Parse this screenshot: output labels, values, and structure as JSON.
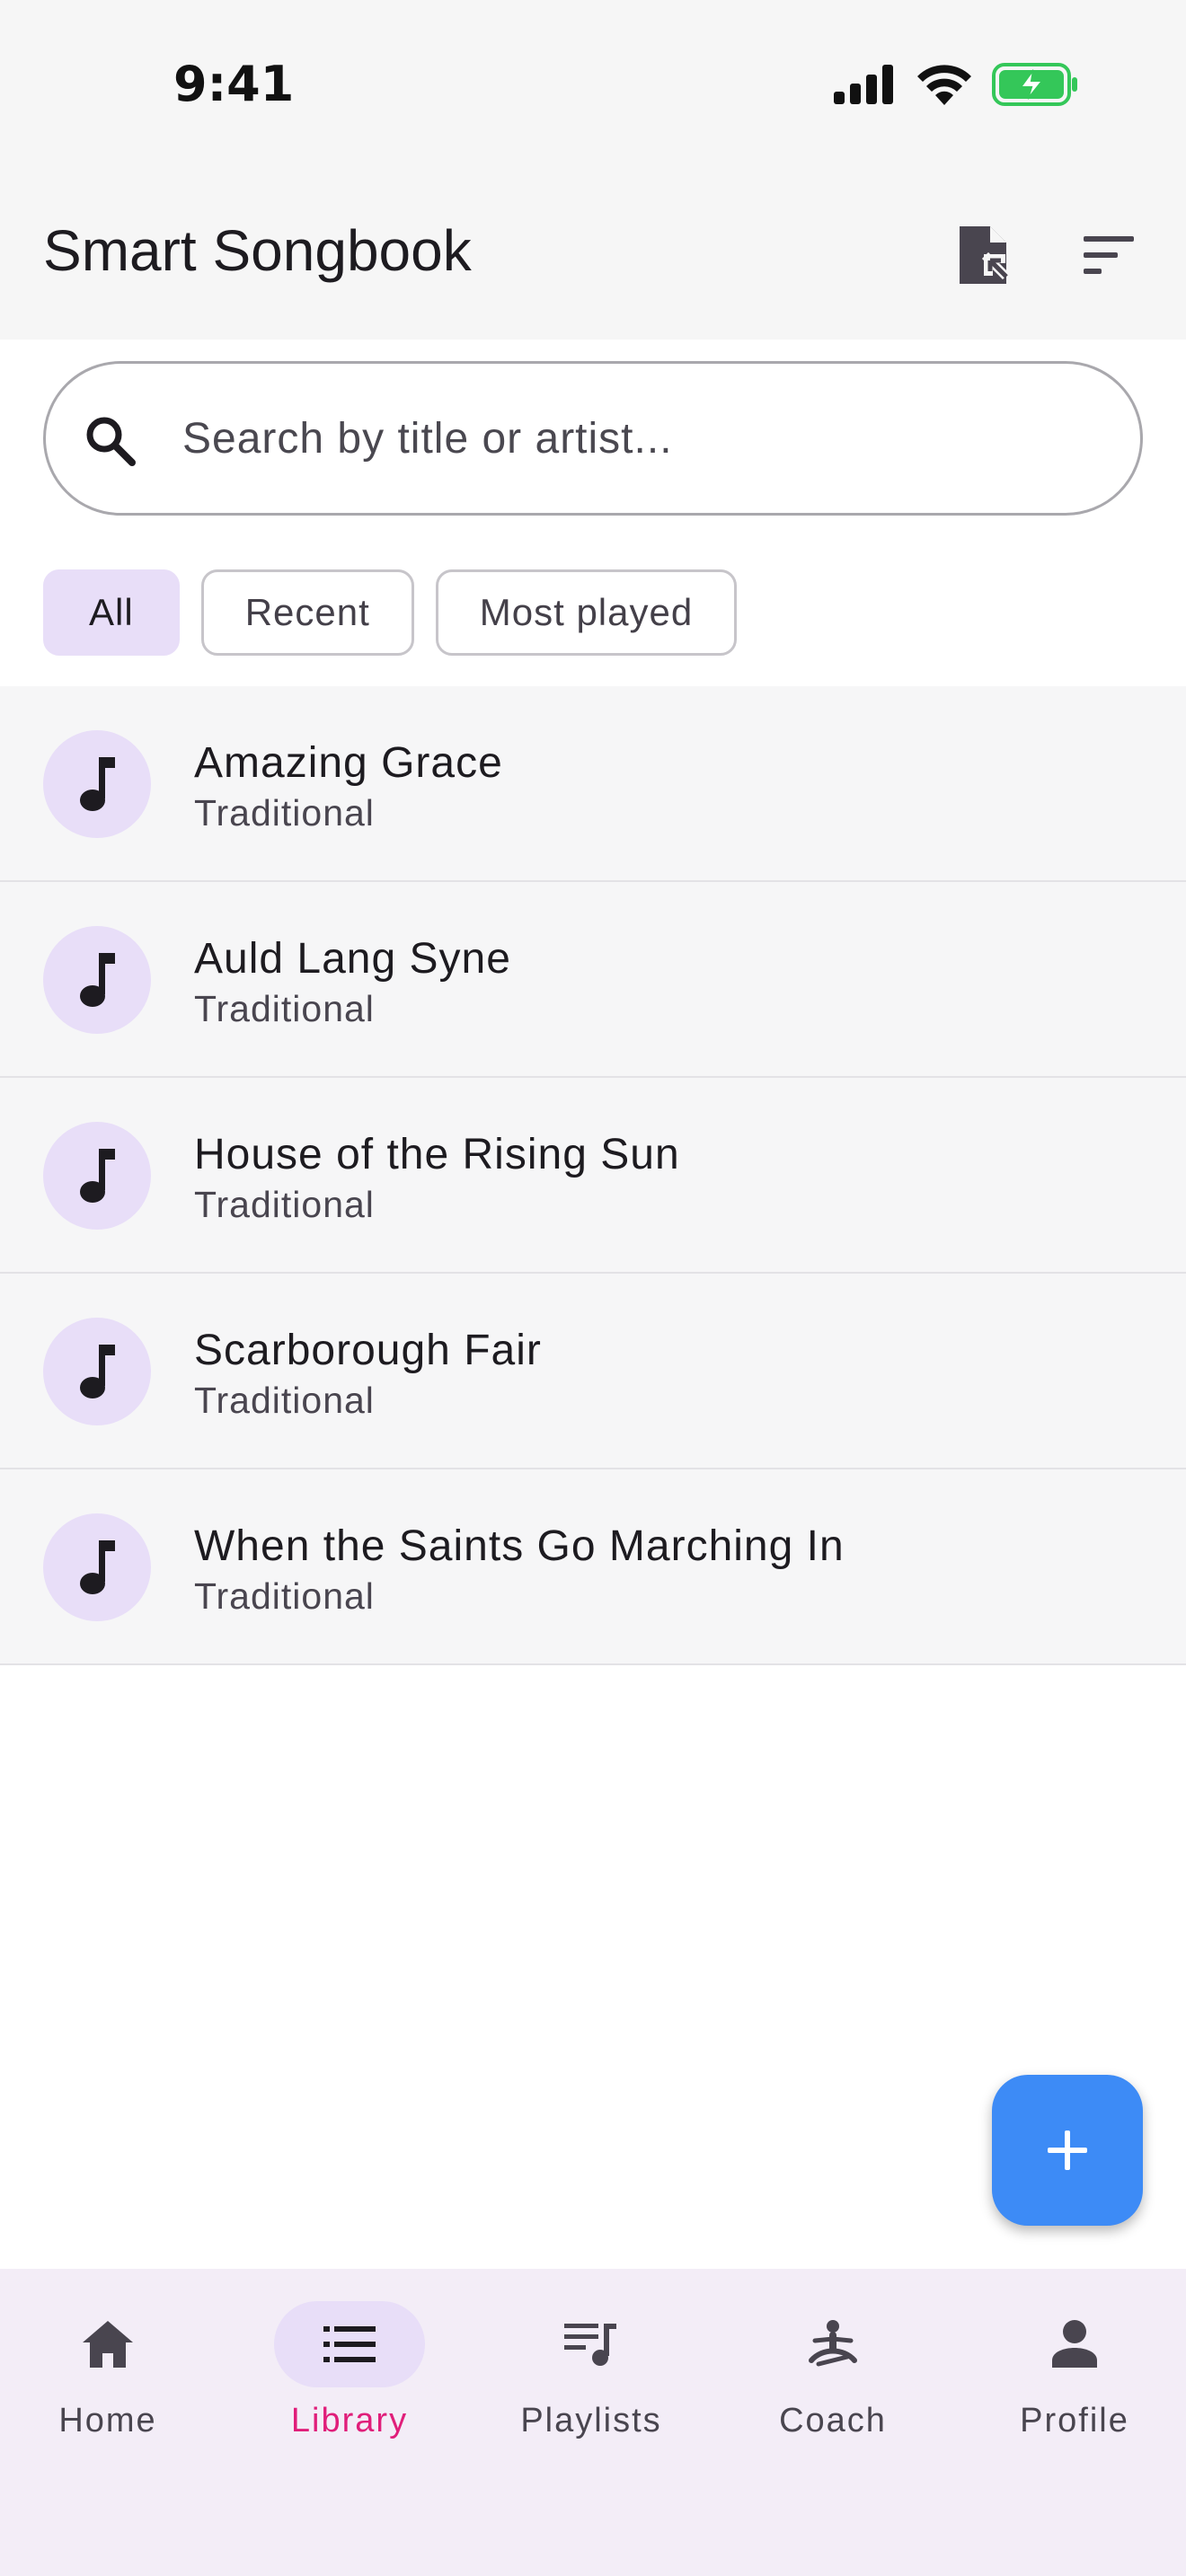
{
  "status_bar": {
    "time": "9:41",
    "icons": [
      "signal-icon",
      "wifi-icon",
      "battery-charging-icon"
    ]
  },
  "app_bar": {
    "title": "Smart Songbook",
    "actions": [
      {
        "name": "import-file-icon",
        "label": "Import"
      },
      {
        "name": "sort-icon",
        "label": "Sort"
      }
    ]
  },
  "search": {
    "placeholder": "Search by title or artist...",
    "value": ""
  },
  "filters": [
    {
      "label": "All",
      "selected": true
    },
    {
      "label": "Recent",
      "selected": false
    },
    {
      "label": "Most played",
      "selected": false
    }
  ],
  "songs": [
    {
      "title": "Amazing Grace",
      "artist": "Traditional"
    },
    {
      "title": "Auld Lang Syne",
      "artist": "Traditional"
    },
    {
      "title": "House of the Rising Sun",
      "artist": "Traditional"
    },
    {
      "title": "Scarborough Fair",
      "artist": "Traditional"
    },
    {
      "title": "When the Saints Go Marching In",
      "artist": "Traditional"
    }
  ],
  "fab": {
    "icon": "add-icon"
  },
  "bottom_nav": [
    {
      "label": "Home",
      "icon": "home-icon",
      "active": false
    },
    {
      "label": "Library",
      "icon": "list-icon",
      "active": true
    },
    {
      "label": "Playlists",
      "icon": "playlist-icon",
      "active": false
    },
    {
      "label": "Coach",
      "icon": "coach-icon",
      "active": false
    },
    {
      "label": "Profile",
      "icon": "person-icon",
      "active": false
    }
  ],
  "colors": {
    "accent": "#3d8bf6",
    "chip_selected": "#e8def8",
    "nav_active_label": "#e01e7a",
    "battery": "#34c759"
  }
}
